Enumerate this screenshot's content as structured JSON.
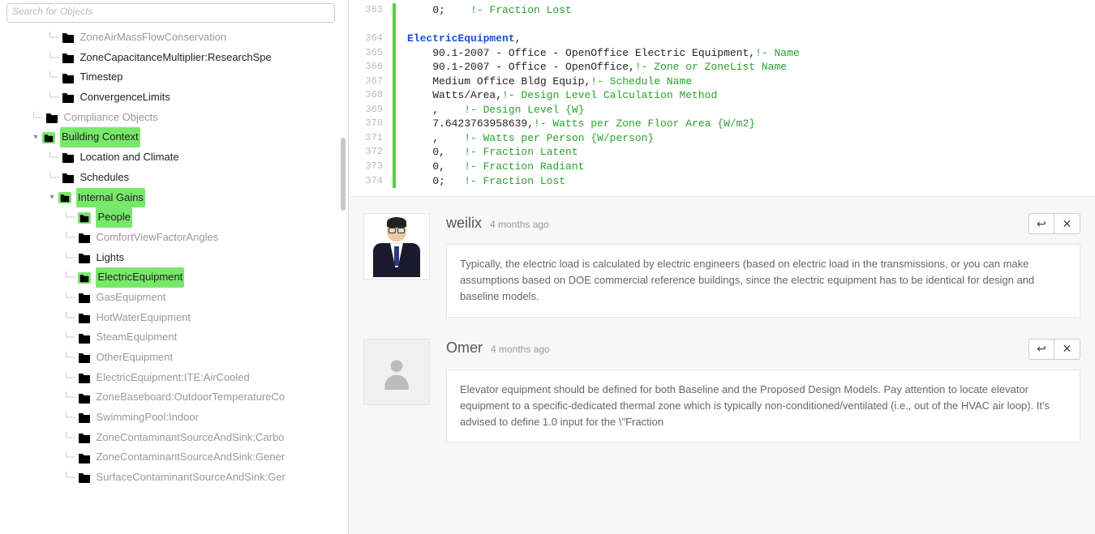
{
  "search": {
    "placeholder": "Search for Objects"
  },
  "tree": {
    "items": [
      {
        "indent": "i2",
        "branch": "└─",
        "icon": "gray",
        "label": "ZoneAirMassFlowConservation",
        "active": false,
        "hl": false,
        "toggle": ""
      },
      {
        "indent": "i2",
        "branch": "└─",
        "icon": "dark",
        "label": "ZoneCapacitanceMultiplier:ResearchSpe",
        "active": true,
        "hl": false,
        "toggle": ""
      },
      {
        "indent": "i2",
        "branch": "└─",
        "icon": "dark",
        "label": "Timestep",
        "active": true,
        "hl": false,
        "toggle": ""
      },
      {
        "indent": "i2",
        "branch": "└─",
        "icon": "dark",
        "label": "ConvergenceLimits",
        "active": true,
        "hl": false,
        "toggle": ""
      },
      {
        "indent": "i1",
        "branch": "└─",
        "icon": "gray",
        "label": "Compliance Objects",
        "active": false,
        "hl": false,
        "toggle": ""
      },
      {
        "indent": "i1",
        "branch": "",
        "icon": "dark",
        "label": "Building Context",
        "active": true,
        "hl": true,
        "toggle": "▾"
      },
      {
        "indent": "i2",
        "branch": "└─",
        "icon": "dark",
        "label": "Location and Climate",
        "active": true,
        "hl": false,
        "toggle": ""
      },
      {
        "indent": "i2",
        "branch": "└─",
        "icon": "dark",
        "label": "Schedules",
        "active": true,
        "hl": false,
        "toggle": ""
      },
      {
        "indent": "i2",
        "branch": "",
        "icon": "dark",
        "label": "Internal Gains",
        "active": true,
        "hl": true,
        "toggle": "▾"
      },
      {
        "indent": "i3",
        "branch": "└─",
        "icon": "dark",
        "label": "People",
        "active": true,
        "hl": true,
        "toggle": ""
      },
      {
        "indent": "i3",
        "branch": "└─",
        "icon": "gray",
        "label": "ComfortViewFactorAngles",
        "active": false,
        "hl": false,
        "toggle": ""
      },
      {
        "indent": "i3",
        "branch": "└─",
        "icon": "dark",
        "label": "Lights",
        "active": true,
        "hl": false,
        "toggle": ""
      },
      {
        "indent": "i3",
        "branch": "└─",
        "icon": "dark",
        "label": "ElectricEquipment",
        "active": true,
        "hl": true,
        "toggle": ""
      },
      {
        "indent": "i3",
        "branch": "└─",
        "icon": "gray",
        "label": "GasEquipment",
        "active": false,
        "hl": false,
        "toggle": ""
      },
      {
        "indent": "i3",
        "branch": "└─",
        "icon": "gray",
        "label": "HotWaterEquipment",
        "active": false,
        "hl": false,
        "toggle": ""
      },
      {
        "indent": "i3",
        "branch": "└─",
        "icon": "gray",
        "label": "SteamEquipment",
        "active": false,
        "hl": false,
        "toggle": ""
      },
      {
        "indent": "i3",
        "branch": "└─",
        "icon": "gray",
        "label": "OtherEquipment",
        "active": false,
        "hl": false,
        "toggle": ""
      },
      {
        "indent": "i3",
        "branch": "└─",
        "icon": "gray",
        "label": "ElectricEquipment:ITE:AirCooled",
        "active": false,
        "hl": false,
        "toggle": ""
      },
      {
        "indent": "i3",
        "branch": "└─",
        "icon": "gray",
        "label": "ZoneBaseboard:OutdoorTemperatureCo",
        "active": false,
        "hl": false,
        "toggle": ""
      },
      {
        "indent": "i3",
        "branch": "└─",
        "icon": "gray",
        "label": "SwimmingPool:Indoor",
        "active": false,
        "hl": false,
        "toggle": ""
      },
      {
        "indent": "i3",
        "branch": "└─",
        "icon": "gray",
        "label": "ZoneContaminantSourceAndSink:Carbo",
        "active": false,
        "hl": false,
        "toggle": ""
      },
      {
        "indent": "i3",
        "branch": "└─",
        "icon": "gray",
        "label": "ZoneContaminantSourceAndSink:Gener",
        "active": false,
        "hl": false,
        "toggle": ""
      },
      {
        "indent": "i3",
        "branch": "└─",
        "icon": "gray",
        "label": "SurfaceContaminantSourceAndSink:Ger",
        "active": false,
        "hl": false,
        "toggle": ""
      }
    ]
  },
  "code": {
    "lines": [
      {
        "n": "363",
        "segs": [
          {
            "c": "txt",
            "t": "    0;    "
          },
          {
            "c": "cm",
            "t": "!- Fraction Lost"
          }
        ]
      },
      {
        "n": "",
        "segs": [
          {
            "c": "txt",
            "t": " "
          }
        ]
      },
      {
        "n": "364",
        "segs": [
          {
            "c": "kw",
            "t": "ElectricEquipment"
          },
          {
            "c": "txt",
            "t": ","
          }
        ]
      },
      {
        "n": "365",
        "segs": [
          {
            "c": "txt",
            "t": "    90.1-2007 - Office - OpenOffice Electric Equipment,"
          },
          {
            "c": "cm",
            "t": "!- Name"
          }
        ]
      },
      {
        "n": "366",
        "segs": [
          {
            "c": "txt",
            "t": "    90.1-2007 - Office - OpenOffice,"
          },
          {
            "c": "cm",
            "t": "!- Zone or ZoneList Name"
          }
        ]
      },
      {
        "n": "367",
        "segs": [
          {
            "c": "txt",
            "t": "    Medium Office Bldg Equip,"
          },
          {
            "c": "cm",
            "t": "!- Schedule Name"
          }
        ]
      },
      {
        "n": "368",
        "segs": [
          {
            "c": "txt",
            "t": "    Watts/Area,"
          },
          {
            "c": "cm",
            "t": "!- Design Level Calculation Method"
          }
        ]
      },
      {
        "n": "369",
        "segs": [
          {
            "c": "txt",
            "t": "    ,    "
          },
          {
            "c": "cm",
            "t": "!- Design Level {W}"
          }
        ]
      },
      {
        "n": "370",
        "segs": [
          {
            "c": "txt",
            "t": "    7.6423763958639,"
          },
          {
            "c": "cm",
            "t": "!- Watts per Zone Floor Area {W/m2}"
          }
        ]
      },
      {
        "n": "371",
        "segs": [
          {
            "c": "txt",
            "t": "    ,    "
          },
          {
            "c": "cm",
            "t": "!- Watts per Person {W/person}"
          }
        ]
      },
      {
        "n": "372",
        "segs": [
          {
            "c": "txt",
            "t": "    0,   "
          },
          {
            "c": "cm",
            "t": "!- Fraction Latent"
          }
        ]
      },
      {
        "n": "373",
        "segs": [
          {
            "c": "txt",
            "t": "    0,   "
          },
          {
            "c": "cm",
            "t": "!- Fraction Radiant"
          }
        ]
      },
      {
        "n": "374",
        "segs": [
          {
            "c": "txt",
            "t": "    0;   "
          },
          {
            "c": "cm",
            "t": "!- Fraction Lost"
          }
        ]
      }
    ]
  },
  "comments": [
    {
      "name": "weilix",
      "time": "4 months ago",
      "avatar": "photo",
      "text": "Typically, the electric load is calculated by electric engineers (based on electric load in the transmissions, or you can make assumptions based on DOE commercial reference buildings, since the electric equipment has to be identical for design and baseline models."
    },
    {
      "name": "Omer",
      "time": "4 months ago",
      "avatar": "generic",
      "text": "Elevator equipment should be defined for both Baseline and the Proposed Design Models. Pay attention to locate elevator equipment to a specific-dedicated thermal zone which is typically non-conditioned/ventilated (i.e., out of the HVAC air loop). It's advised to define 1.0 input for the \\\"Fraction"
    }
  ],
  "icons": {
    "reply": "↩",
    "close": "✕"
  }
}
